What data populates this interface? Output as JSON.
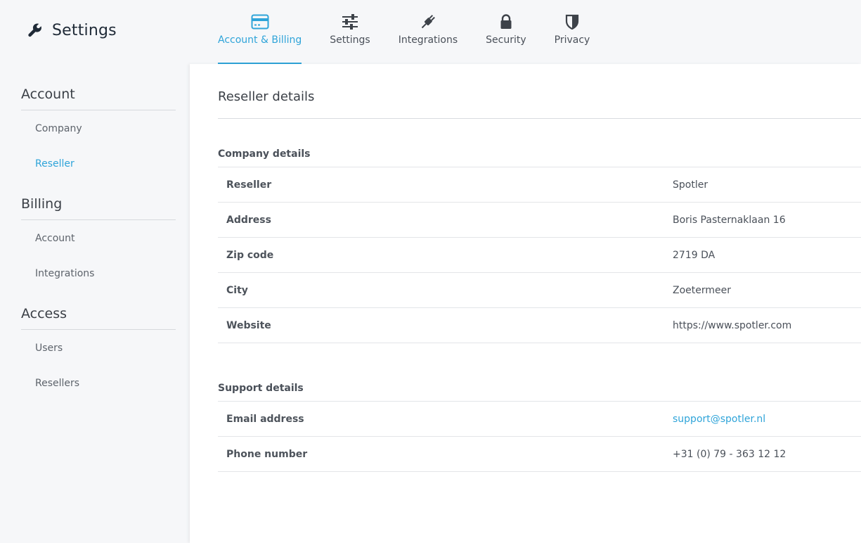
{
  "app": {
    "title": "Settings",
    "icon": "wrench-icon"
  },
  "tabs": [
    {
      "label": "Account & Billing",
      "icon": "credit-card-icon",
      "active": true
    },
    {
      "label": "Settings",
      "icon": "sliders-icon",
      "active": false
    },
    {
      "label": "Integrations",
      "icon": "plug-icon",
      "active": false
    },
    {
      "label": "Security",
      "icon": "lock-icon",
      "active": false
    },
    {
      "label": "Privacy",
      "icon": "shield-icon",
      "active": false
    }
  ],
  "sidebar": {
    "groups": [
      {
        "title": "Account",
        "items": [
          {
            "label": "Company"
          },
          {
            "label": "Reseller",
            "active": true
          }
        ]
      },
      {
        "title": "Billing",
        "items": [
          {
            "label": "Account"
          },
          {
            "label": "Integrations"
          }
        ]
      },
      {
        "title": "Access",
        "items": [
          {
            "label": "Users"
          },
          {
            "label": "Resellers"
          }
        ]
      }
    ]
  },
  "main": {
    "title": "Reseller details",
    "company": {
      "title": "Company details",
      "rows": [
        {
          "label": "Reseller",
          "value": "Spotler"
        },
        {
          "label": "Address",
          "value": "Boris Pasternaklaan 16"
        },
        {
          "label": "Zip code",
          "value": "2719 DA"
        },
        {
          "label": "City",
          "value": "Zoetermeer"
        },
        {
          "label": "Website",
          "value": "https://www.spotler.com"
        }
      ]
    },
    "support": {
      "title": "Support details",
      "rows": [
        {
          "label": "Email address",
          "value": "support@spotler.nl"
        },
        {
          "label": "Phone number",
          "value": "+31 (0) 79 - 363 12 12"
        }
      ]
    }
  },
  "colors": {
    "accent": "#2fa4d9",
    "icon": "#3d4249"
  }
}
